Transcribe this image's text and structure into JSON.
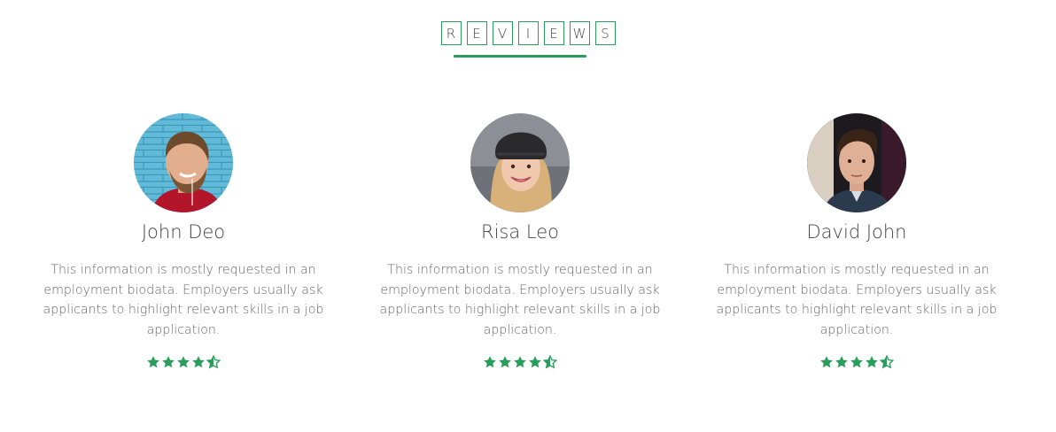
{
  "section": {
    "title_letters": [
      "R",
      "E",
      "V",
      "I",
      "E",
      "W",
      "S"
    ]
  },
  "colors": {
    "accent": "#2a9d5c",
    "text": "#666666",
    "name": "#444444"
  },
  "reviews": [
    {
      "name": "John Deo",
      "text": "This information is mostly requested in an employment biodata. Employers usually ask applicants to highlight relevant skills in a job application.",
      "rating": 4.5,
      "rating_max": 5,
      "avatar_icon": "avatar-photo-man-smiling"
    },
    {
      "name": "Risa Leo",
      "text": "This information is mostly requested in an employment biodata. Employers usually ask applicants to highlight relevant skills in a job application.",
      "rating": 4.5,
      "rating_max": 5,
      "avatar_icon": "avatar-photo-woman-beanie"
    },
    {
      "name": "David John",
      "text": "This information is mostly requested in an employment biodata. Employers usually ask applicants to highlight relevant skills in a job application.",
      "rating": 4.5,
      "rating_max": 5,
      "avatar_icon": "avatar-photo-man-dark"
    }
  ]
}
